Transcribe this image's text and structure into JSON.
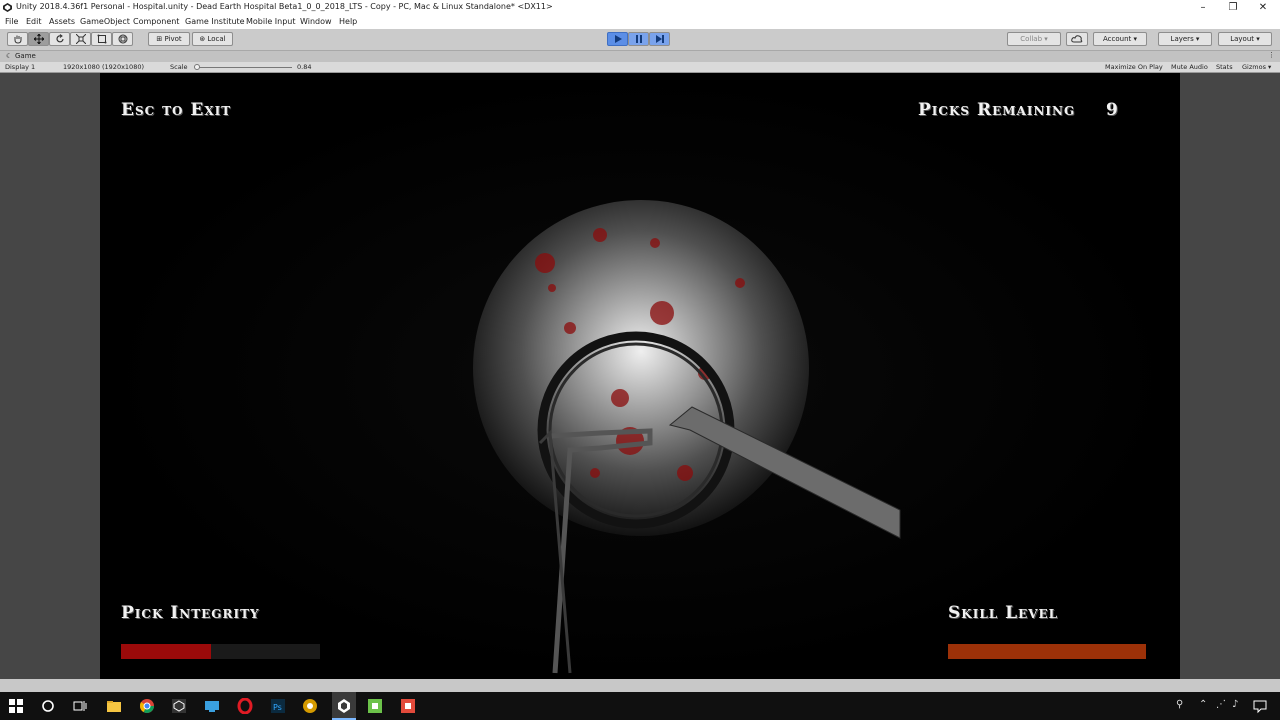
{
  "window": {
    "title": "Unity 2018.4.36f1 Personal - Hospital.unity - Dead Earth Hospital Beta1_0_0_2018_LTS - Copy - PC, Mac & Linux Standalone* <DX11>",
    "minimize": "–",
    "maximize": "❐",
    "close": "✕"
  },
  "menu": [
    "File",
    "Edit",
    "Assets",
    "GameObject",
    "Component",
    "Game Institute",
    "Mobile Input",
    "Window",
    "Help"
  ],
  "toolbar": {
    "pivot_label": "Pivot",
    "local_label": "Local",
    "collab_label": "Collab ▾",
    "account_label": "Account ▾",
    "layers_label": "Layers ▾",
    "layout_label": "Layout ▾"
  },
  "game_tab": {
    "label": "Game",
    "display": "Display 1",
    "resolution": "1920x1080 (1920x1080)",
    "scale_label": "Scale",
    "scale_value": "0.84",
    "scale_fraction": 0.04,
    "maximize_on_play": "Maximize On Play",
    "mute_audio": "Mute Audio",
    "stats": "Stats",
    "gizmos": "Gizmos ▾"
  },
  "hud": {
    "exit_label": "Esc to Exit",
    "picks_label": "Picks Remaining",
    "picks_value": "9",
    "integrity_label": "Pick Integrity",
    "integrity_fraction": 0.45,
    "skill_label": "Skill Level",
    "skill_fraction": 1.0
  },
  "colors": {
    "integrity_bar": "#9b0a0a",
    "skill_bar": "#9c3108",
    "play_active": "#5b8ee6"
  },
  "icons": {
    "hand_tool": "hand-icon",
    "move_tool": "move-icon",
    "rotate_tool": "rotate-icon",
    "scale_tool": "scale-icon",
    "rect_tool": "rect-icon",
    "transform_tool": "transform-icon",
    "play": "play-icon",
    "pause": "pause-icon",
    "step": "step-icon",
    "cloud": "cloud-icon"
  }
}
